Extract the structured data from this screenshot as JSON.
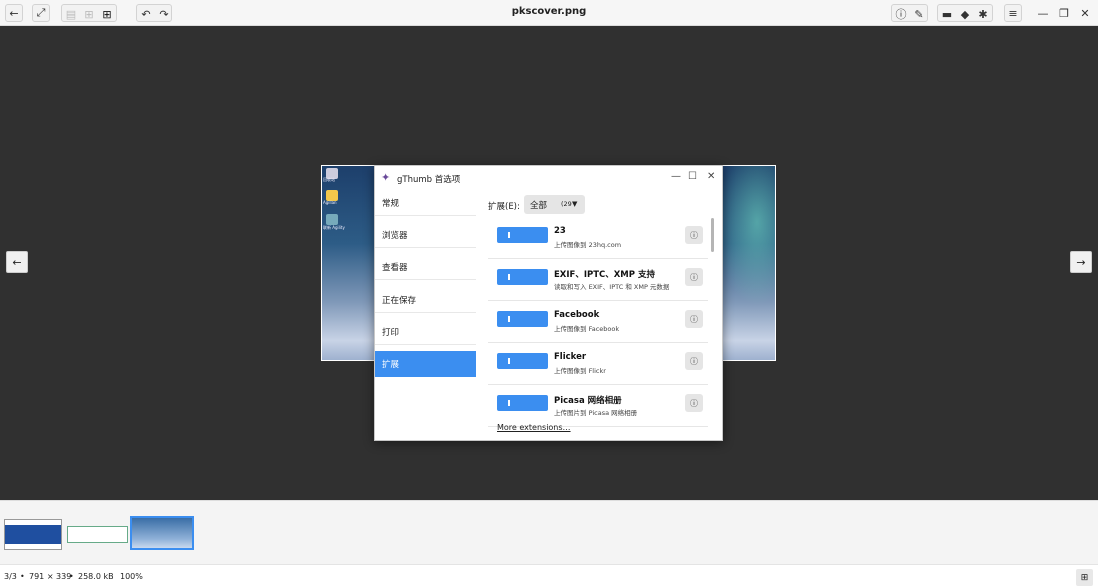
{
  "window": {
    "title": "pkscover.png"
  },
  "dialog": {
    "title": "gThumb 首选项",
    "sidebar": [
      "常规",
      "浏览器",
      "查看器",
      "正在保存",
      "打印",
      "扩展"
    ],
    "selected_index": 5,
    "ext_label": "扩展(E):",
    "filter": {
      "value": "全部",
      "count": "(29"
    },
    "extensions": [
      {
        "name": "23",
        "desc": "上传图像到 23hq.com"
      },
      {
        "name": "EXIF、IPTC、XMP 支持",
        "desc": "读取和写入 EXIF、IPTC 和 XMP 元数据"
      },
      {
        "name": "Facebook",
        "desc": "上传图像到 Facebook"
      },
      {
        "name": "Flicker",
        "desc": "上传图像到 Flickr"
      },
      {
        "name": "Picasa 网络相册",
        "desc": "上传图片到 Picasa 网络相册"
      }
    ],
    "more": "More extensions…"
  },
  "desktop_icons": [
    "回收站",
    "Agillan",
    "联新 Agility"
  ],
  "status": {
    "position": "3/3",
    "dimensions": "791 × 339",
    "size": "258.0 kB",
    "zoom": "100%"
  },
  "colors": {
    "accent": "#3b8ef0",
    "viewer_bg": "#303030"
  }
}
